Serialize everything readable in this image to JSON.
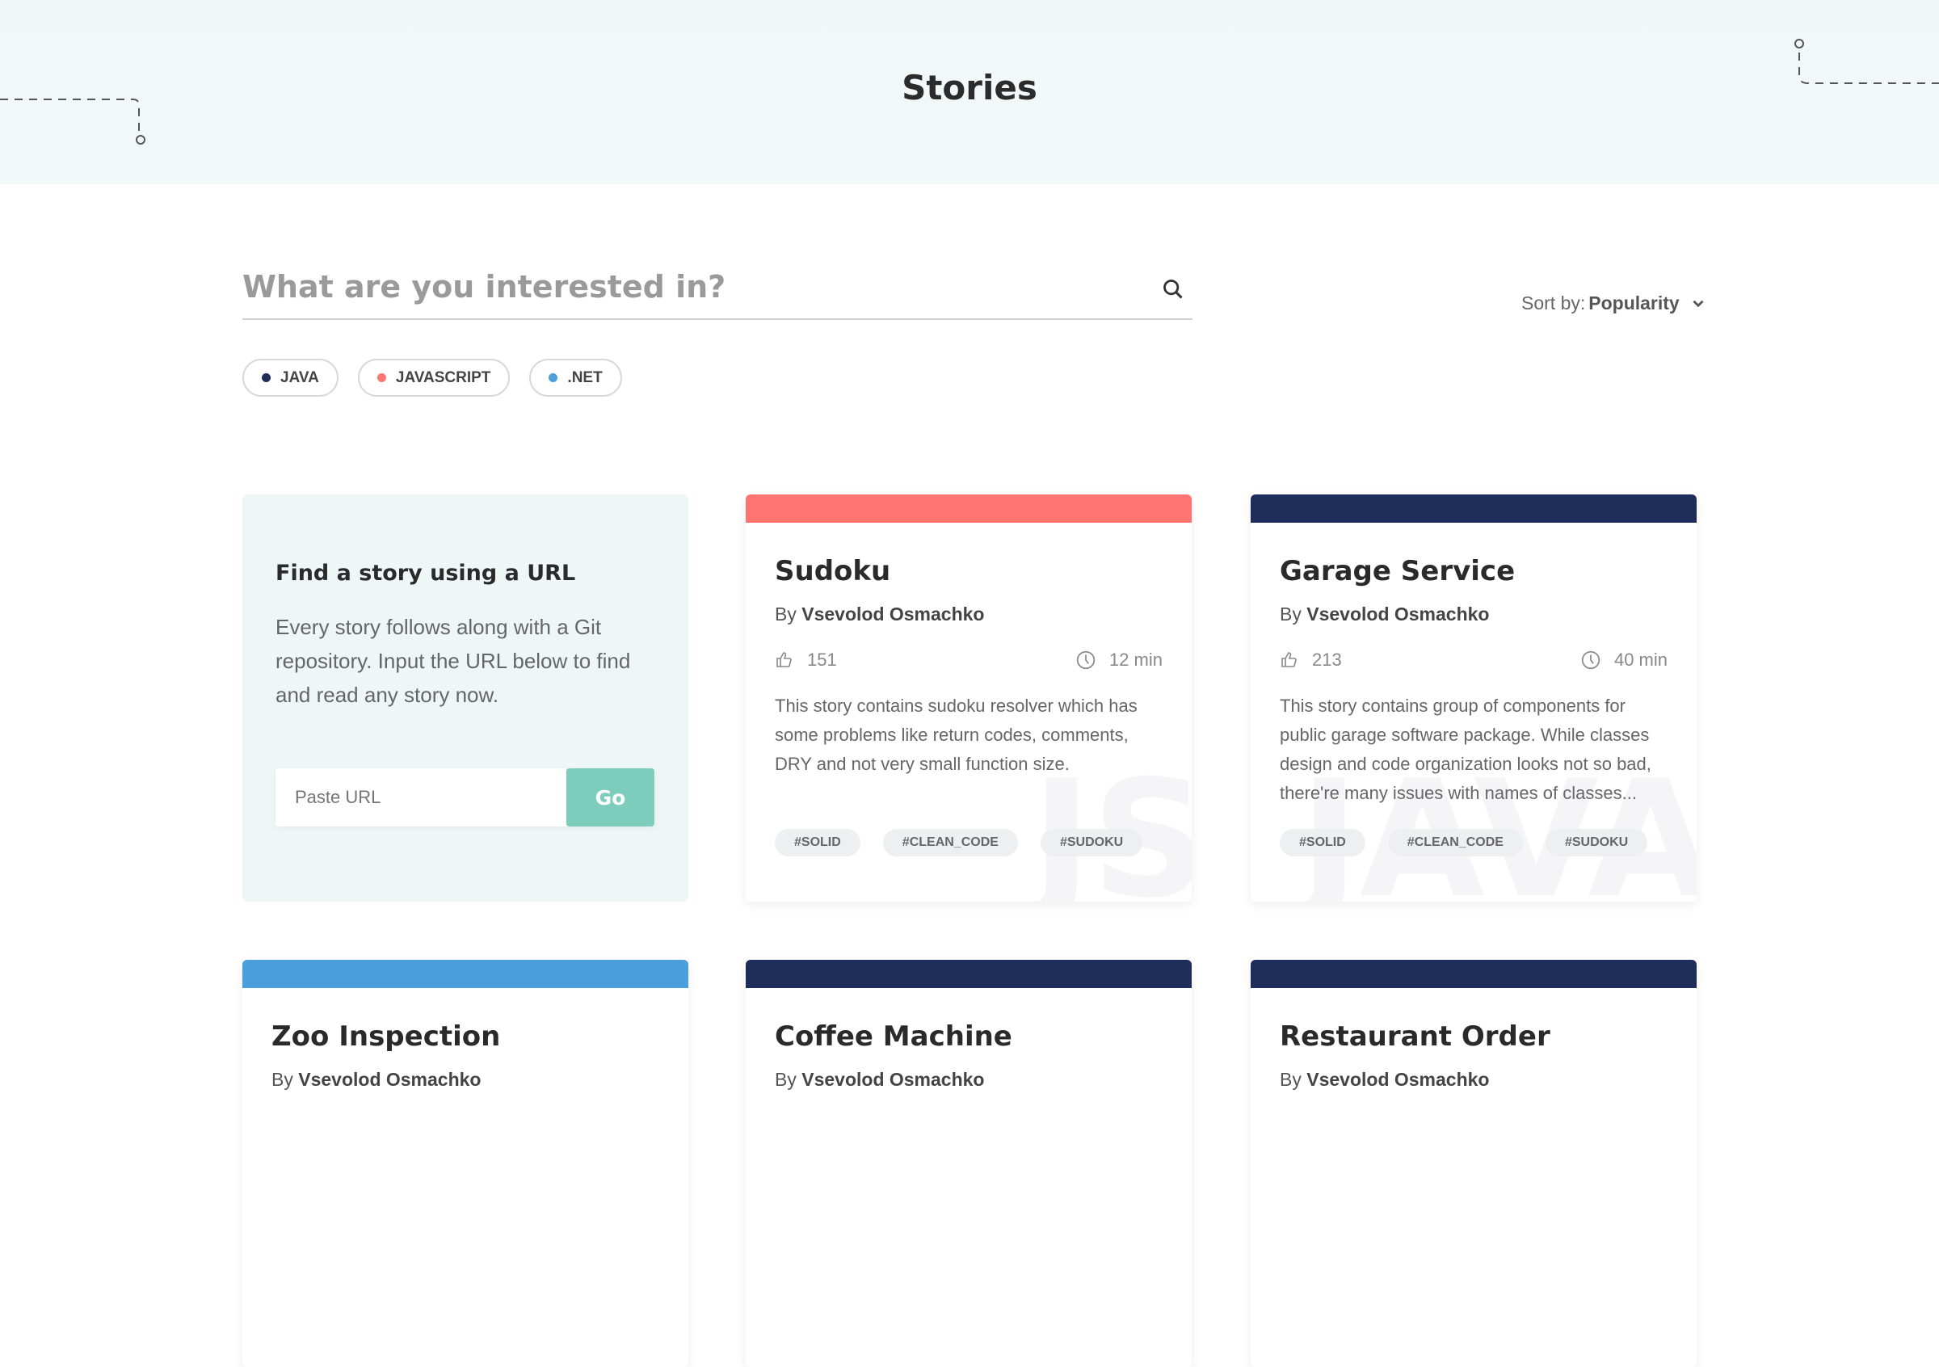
{
  "header": {
    "title": "Stories"
  },
  "search": {
    "placeholder": "What are you interested in?",
    "icon": "search-icon"
  },
  "sort": {
    "label": "Sort by:",
    "value": "Popularity"
  },
  "filters": [
    {
      "label": "JAVA",
      "color": "#1e2d5a"
    },
    {
      "label": "JAVASCRIPT",
      "color": "#ff7470"
    },
    {
      "label": ".NET",
      "color": "#4a9fdc"
    }
  ],
  "url_card": {
    "title": "Find a story using a URL",
    "text": "Every story follows along with a Git repository. Input the URL below to find and read any story now.",
    "placeholder": "Paste URL",
    "button": "Go"
  },
  "stories": [
    {
      "title": "Sudoku",
      "by": "By",
      "author": "Vsevolod Osmachko",
      "likes": "151",
      "time": "12 min",
      "description": "This story contains sudoku resolver which has some problems like return codes, comments, DRY and not very small function size.",
      "tags": [
        "#SOLID",
        "#CLEAN_CODE",
        "#SUDOKU"
      ],
      "color": "#ff7470",
      "watermark": "JS"
    },
    {
      "title": "Garage Service",
      "by": "By",
      "author": "Vsevolod Osmachko",
      "likes": "213",
      "time": "40 min",
      "description": "This story contains group of components for public garage software package. While classes design and code organization looks not so bad, there're many issues with names of classes...",
      "tags": [
        "#SOLID",
        "#CLEAN_CODE",
        "#SUDOKU"
      ],
      "color": "#1e2d5a",
      "watermark": "JAVA"
    },
    {
      "title": "Zoo Inspection",
      "by": "By",
      "author": "Vsevolod Osmachko",
      "color": "#4a9fdc"
    },
    {
      "title": "Coffee Machine",
      "by": "By",
      "author": "Vsevolod Osmachko",
      "color": "#1e2d5a"
    },
    {
      "title": "Restaurant Order",
      "by": "By",
      "author": "Vsevolod Osmachko",
      "color": "#1e2d5a"
    }
  ]
}
